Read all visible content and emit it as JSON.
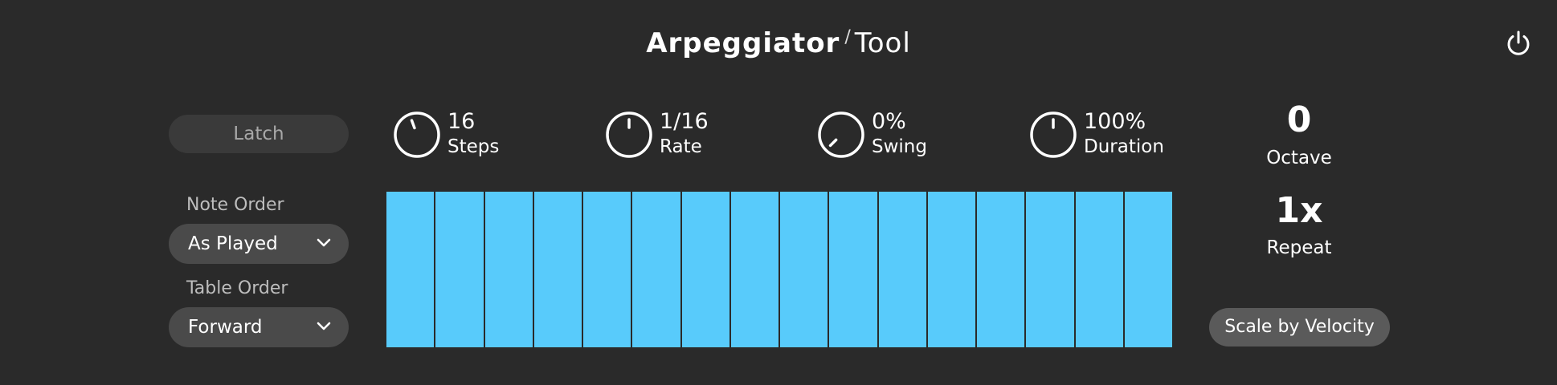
{
  "header": {
    "title_bold": "Arpeggiator",
    "title_slash": "/",
    "title_light": "Tool",
    "power_icon": "power-icon"
  },
  "left_panel": {
    "latch_label": "Latch",
    "note_order": {
      "label": "Note Order",
      "value": "As Played"
    },
    "table_order": {
      "label": "Table Order",
      "value": "Forward"
    }
  },
  "knobs": [
    {
      "value": "16",
      "label": "Steps",
      "indicator_angle_deg": -20
    },
    {
      "value": "1/16",
      "label": "Rate",
      "indicator_angle_deg": 0
    },
    {
      "value": "0%",
      "label": "Swing",
      "indicator_angle_deg": -135
    },
    {
      "value": "100%",
      "label": "Duration",
      "indicator_angle_deg": 0
    }
  ],
  "steps": {
    "count": 16,
    "levels": [
      1,
      1,
      1,
      1,
      1,
      1,
      1,
      1,
      1,
      1,
      1,
      1,
      1,
      1,
      1,
      1
    ],
    "color": "#58cbfb"
  },
  "right_panel": {
    "octave": {
      "value": "0",
      "label": "Octave"
    },
    "repeat": {
      "value": "1x",
      "label": "Repeat"
    },
    "scale_by_velocity_label": "Scale by Velocity"
  },
  "colors": {
    "background": "#2a2a2a",
    "accent": "#58cbfb",
    "latch_bg": "#3a3a3a",
    "dropdown_bg": "#4a4a4a",
    "scale_button_bg": "#5a5a5a"
  }
}
